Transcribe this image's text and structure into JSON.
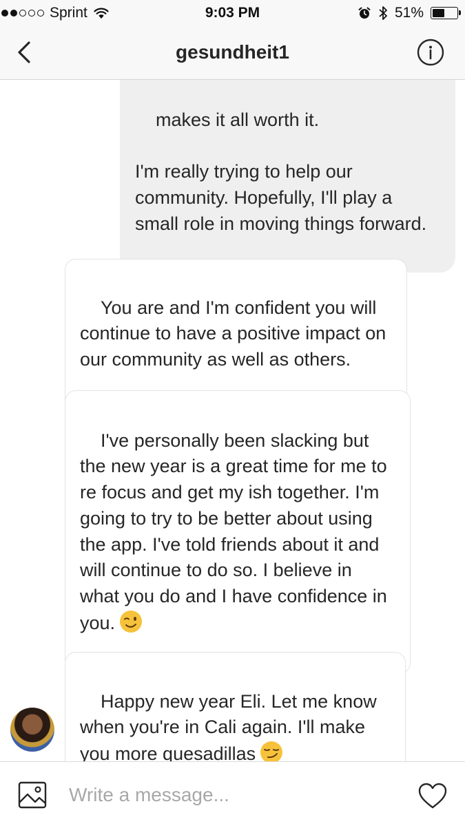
{
  "status_bar": {
    "carrier": "Sprint",
    "time": "9:03 PM",
    "battery_percent": "51%",
    "battery_level": 0.51,
    "icons": [
      "signal-dots-icon",
      "wifi-icon",
      "alarm-icon",
      "bluetooth-icon",
      "battery-icon"
    ]
  },
  "header": {
    "title": "gesundheit1",
    "icons": [
      "back-chevron-icon",
      "info-icon"
    ]
  },
  "messages": [
    {
      "sender": "me",
      "text": "makes it all worth it.\n\nI'm really trying to help our community. Hopefully, I'll play a small role in moving things forward."
    },
    {
      "sender": "them",
      "text": "You are and I'm confident you will continue to have a positive impact on our community as well as others."
    },
    {
      "sender": "them",
      "text": "I've personally been slacking but the new year is a great time for me to re focus and get my ish together. I'm going to try to be better about using the app. I've told friends about it and will continue to do so. I believe in what you do and I have confidence in you.",
      "emoji": "winking-face-emoji"
    },
    {
      "sender": "them",
      "text": "Happy new year Eli. Let me know when you're in Cali again. I'll make you more quesadillas",
      "emoji": "smirking-face-emoji"
    }
  ],
  "composer": {
    "placeholder": "Write a message...",
    "icons": [
      "photo-icon",
      "heart-icon"
    ]
  },
  "colors": {
    "sent_bubble": "#efefef",
    "received_border": "#e3e3e3",
    "text": "#262626",
    "placeholder": "#a8a8a8"
  }
}
